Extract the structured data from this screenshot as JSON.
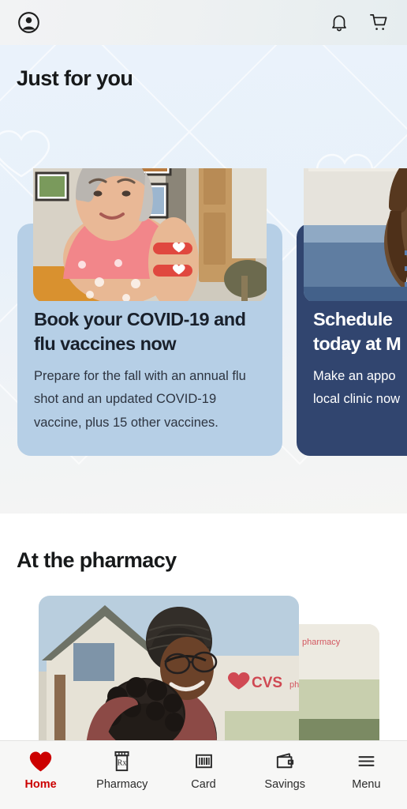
{
  "appbar": {
    "account_icon": "account-circle-icon",
    "bell_icon": "bell-icon",
    "cart_icon": "shopping-cart-icon"
  },
  "just_for_you": {
    "heading": "Just for you",
    "cards": [
      {
        "title": "Book your COVID-19 and flu vaccines now",
        "body": "Prepare for the fall with an annual flu shot and an updated COVID-19 vaccine, plus 15 other vaccines.",
        "bg_color": "#b6cfe6",
        "text_color": "#19202b",
        "image_alt": "senior-woman-with-two-heart-bandages-on-arm"
      },
      {
        "title_line1": "Schedule",
        "title_line2": "today at M",
        "body_line1": "Make an appo",
        "body_line2": "local clinic now",
        "bg_color": "#31456f",
        "text_color": "#ffffff",
        "image_alt": "girl-in-denim-overalls-receiving-vaccination-at-clinic"
      }
    ]
  },
  "pharmacy": {
    "heading": "At the pharmacy",
    "image_alt": "man-in-beanie-hugging-child-outside-cvs-pharmacy-store"
  },
  "bottom_nav": {
    "items": [
      {
        "label": "Home",
        "icon": "heart-icon",
        "active": true
      },
      {
        "label": "Pharmacy",
        "icon": "rx-bottle-icon",
        "active": false
      },
      {
        "label": "Card",
        "icon": "barcode-icon",
        "active": false
      },
      {
        "label": "Savings",
        "icon": "wallet-icon",
        "active": false
      },
      {
        "label": "Menu",
        "icon": "hamburger-menu-icon",
        "active": false
      }
    ],
    "active_color": "#cc0000",
    "inactive_color": "#2b2b2b"
  }
}
